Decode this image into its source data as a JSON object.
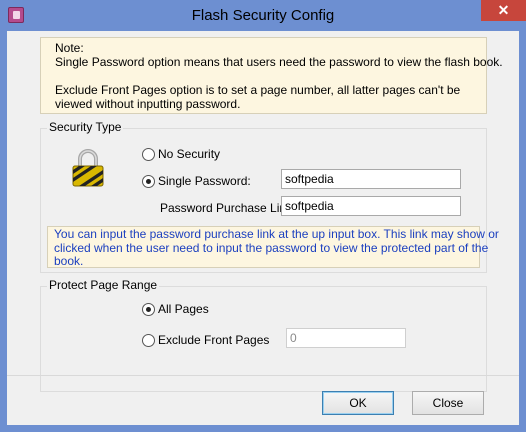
{
  "window": {
    "title": "Flash Security Config",
    "close_glyph": "✕"
  },
  "note": {
    "lines": [
      "Note:",
      "Single Password option means that users need the password to view the flash book.",
      "",
      "Exclude Front Pages option is to set a page number, all latter pages can't be",
      "viewed without inputting password."
    ]
  },
  "security_type": {
    "label": "Security Type",
    "no_security_label": "No Security",
    "single_password_label": "Single Password:",
    "password_value": "softpedia",
    "purchase_link_label": "Password Purchase Link:",
    "purchase_link_value": "softpedia",
    "selected": "single_password",
    "info_lines": [
      "You can input the password purchase link at the up input box. This link may show or",
      "clicked when the user need to input the password to view the protected part of the",
      "book."
    ]
  },
  "page_range": {
    "label": "Protect Page Range",
    "all_pages_label": "All Pages",
    "exclude_label": "Exclude Front Pages",
    "exclude_value": "0",
    "selected": "all_pages"
  },
  "buttons": {
    "ok": "OK",
    "close": "Close"
  },
  "colors": {
    "chrome": "#6d8fd1",
    "close_button": "#c7463c",
    "note_bg": "#fdf6e0",
    "info_text": "#1b3fbf"
  },
  "icons": [
    "app-icon",
    "close-icon",
    "lock-icon"
  ]
}
